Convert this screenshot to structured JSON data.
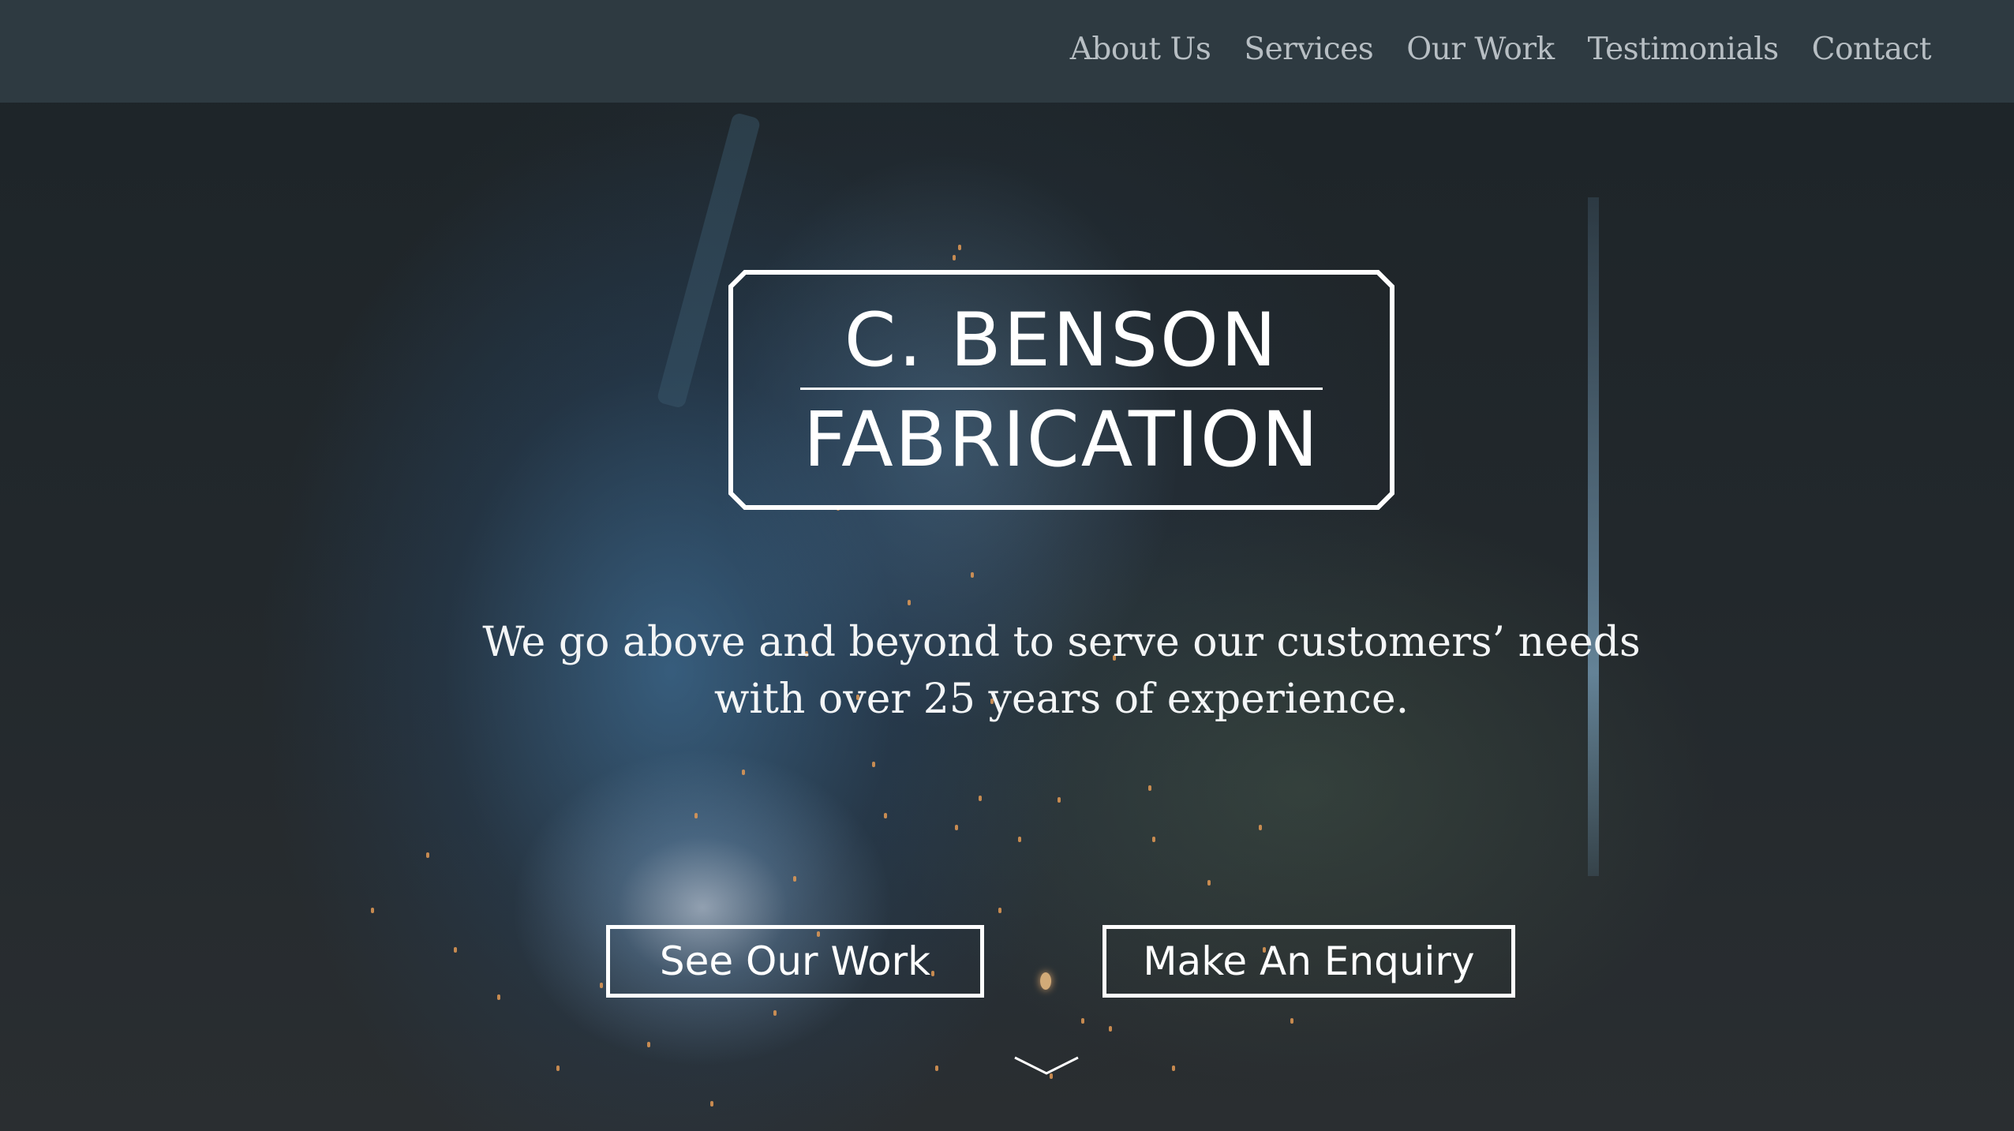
{
  "nav": {
    "items": [
      {
        "label": "About Us"
      },
      {
        "label": "Services"
      },
      {
        "label": "Our Work"
      },
      {
        "label": "Testimonials"
      },
      {
        "label": "Contact"
      }
    ]
  },
  "logo": {
    "line1": "C. BENSON",
    "line2": "FABRICATION"
  },
  "hero": {
    "tagline_line1": "We go above and beyond to serve our customers’ needs",
    "tagline_line2": "with over 25 years of experience.",
    "primary_button": "See Our Work",
    "secondary_button": "Make An Enquiry",
    "scroll_icon": "chevron-down-icon"
  },
  "colors": {
    "header_bg": "#313d44",
    "nav_text": "#b7bec3",
    "text": "#ffffff",
    "spark": "#e39a55"
  }
}
